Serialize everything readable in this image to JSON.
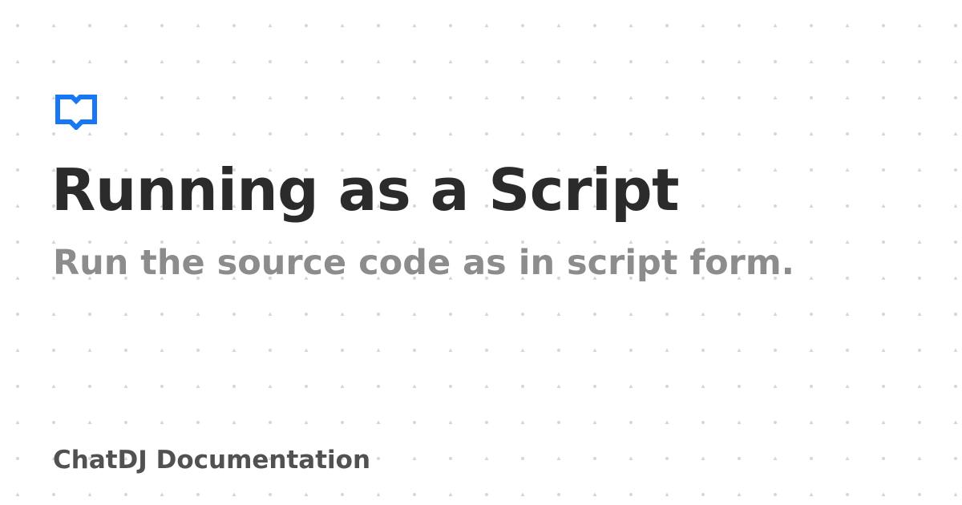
{
  "card": {
    "title": "Running as a Script",
    "subtitle": "Run the source code as in script form.",
    "footer": "ChatDJ Documentation",
    "logo_icon": "open-book-icon"
  },
  "colors": {
    "background": "#ffffff",
    "title": "#2b2b2b",
    "subtitle": "#8c8c8c",
    "footer": "#515151",
    "accent": "#1877f2",
    "pattern": "#d6d6d6"
  }
}
